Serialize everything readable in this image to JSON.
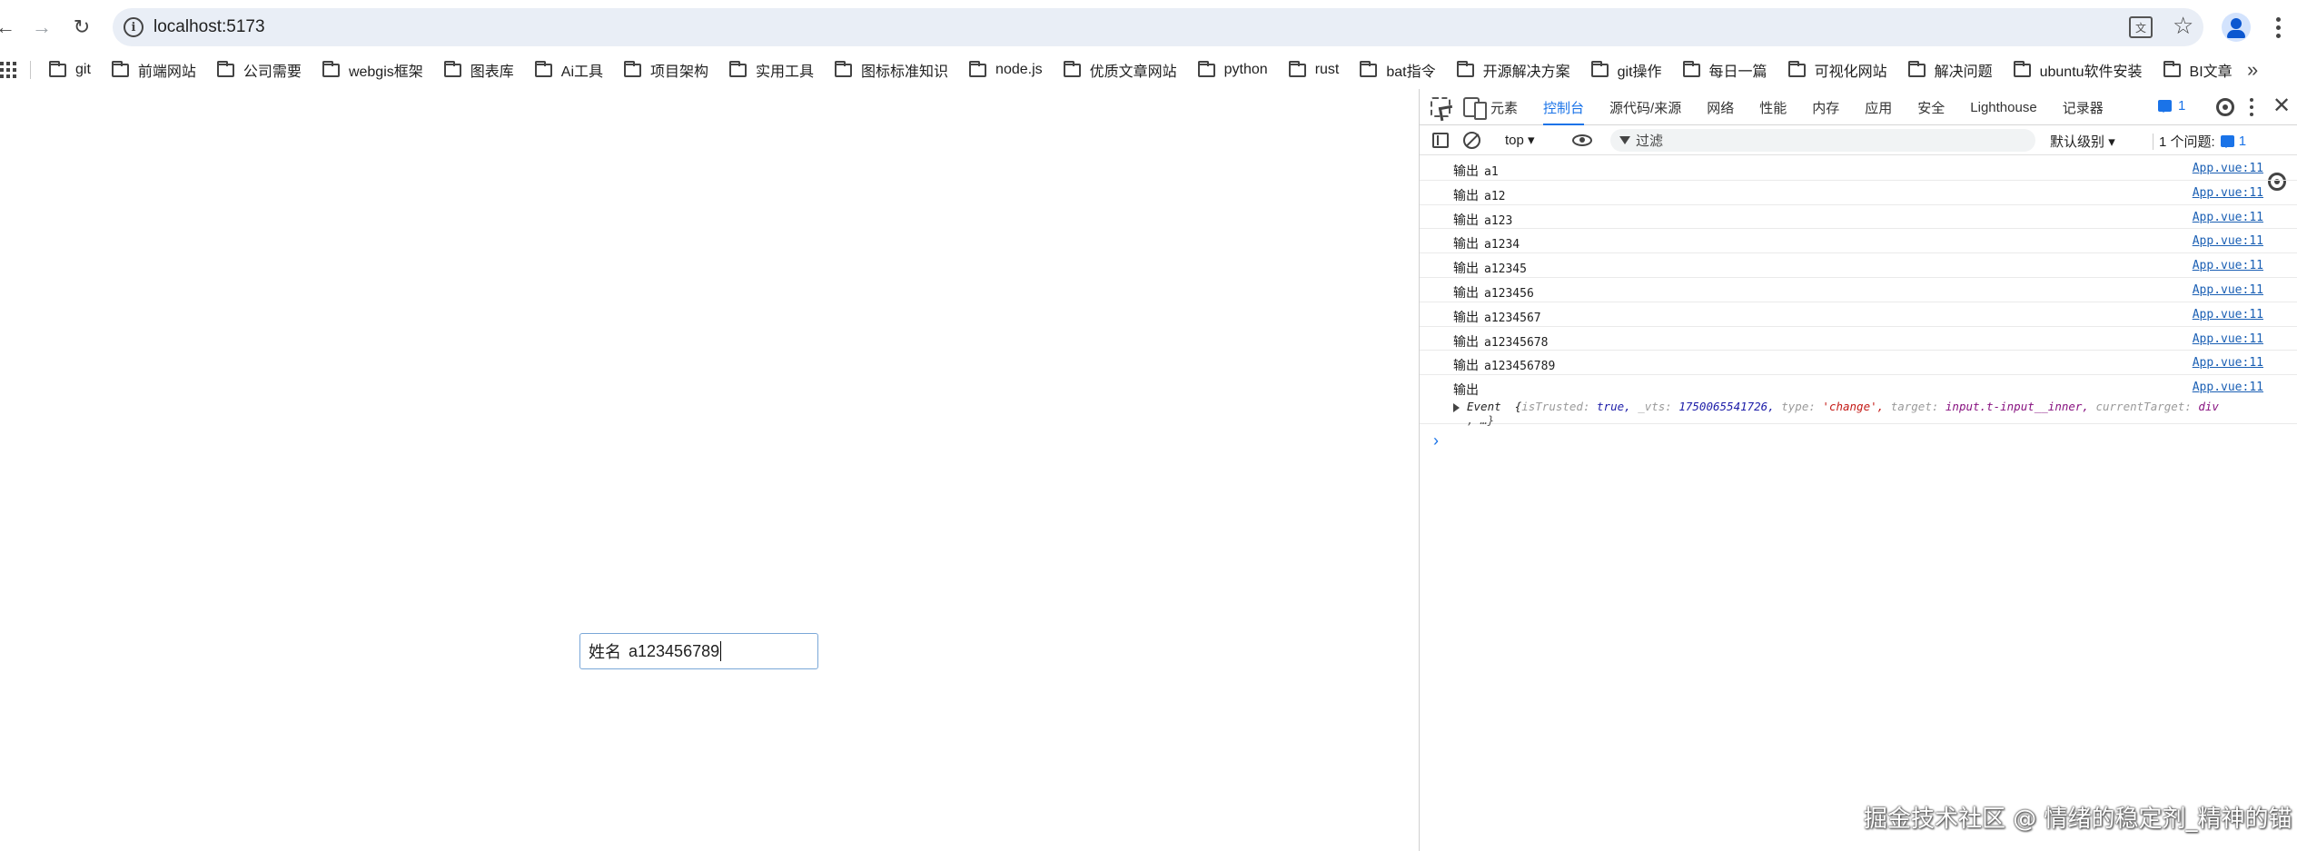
{
  "browser": {
    "url": "localhost:5173",
    "translate_icon": "translate-icon",
    "star_icon": "bookmark-star-icon"
  },
  "bookmarks": [
    {
      "label": "git"
    },
    {
      "label": "前端网站"
    },
    {
      "label": "公司需要"
    },
    {
      "label": "webgis框架"
    },
    {
      "label": "图表库"
    },
    {
      "label": "Ai工具"
    },
    {
      "label": "项目架构"
    },
    {
      "label": "实用工具"
    },
    {
      "label": "图标标准知识"
    },
    {
      "label": "node.js"
    },
    {
      "label": "优质文章网站"
    },
    {
      "label": "python"
    },
    {
      "label": "rust"
    },
    {
      "label": "bat指令"
    },
    {
      "label": "开源解决方案"
    },
    {
      "label": "git操作"
    },
    {
      "label": "每日一篇"
    },
    {
      "label": "可视化网站"
    },
    {
      "label": "解决问题"
    },
    {
      "label": "ubuntu软件安装"
    },
    {
      "label": "BI文章"
    }
  ],
  "page": {
    "name_label": "姓名",
    "name_value": "a123456789"
  },
  "devtools": {
    "tabs": [
      "元素",
      "控制台",
      "源代码/来源",
      "网络",
      "性能",
      "内存",
      "应用",
      "安全",
      "Lighthouse",
      "记录器"
    ],
    "active_tab": "控制台",
    "issues_badge": "1",
    "context": "top",
    "filter_placeholder": "过滤",
    "level": "默认级别",
    "issues_text": "1 个问题:",
    "issues_count": "1",
    "logs": [
      {
        "label": "输出",
        "value": "a1",
        "source": "App.vue:11"
      },
      {
        "label": "输出",
        "value": "a12",
        "source": "App.vue:11"
      },
      {
        "label": "输出",
        "value": "a123",
        "source": "App.vue:11"
      },
      {
        "label": "输出",
        "value": "a1234",
        "source": "App.vue:11"
      },
      {
        "label": "输出",
        "value": "a12345",
        "source": "App.vue:11"
      },
      {
        "label": "输出",
        "value": "a123456",
        "source": "App.vue:11"
      },
      {
        "label": "输出",
        "value": "a1234567",
        "source": "App.vue:11"
      },
      {
        "label": "输出",
        "value": "a12345678",
        "source": "App.vue:11"
      },
      {
        "label": "输出",
        "value": "a123456789",
        "source": "App.vue:11"
      }
    ],
    "event_log": {
      "label": "输出",
      "source": "App.vue:11",
      "name": "Event",
      "isTrusted_key": "isTrusted:",
      "isTrusted_val": "true,",
      "vts_key": "_vts:",
      "vts_val": "1750065541726,",
      "type_key": "type:",
      "type_val": "'change',",
      "target_key": "target:",
      "target_val": "input.t-input__inner,",
      "currentTarget_key": "currentTarget:",
      "currentTarget_val": "div",
      "tail": ", …}"
    }
  },
  "watermark": "掘金技术社区 @ 情绪的稳定剂_精神的锚"
}
